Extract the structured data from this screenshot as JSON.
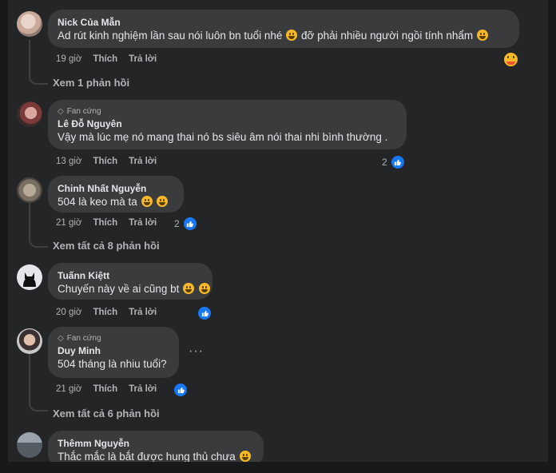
{
  "comments": [
    {
      "name": "Nick Của Mẫn",
      "text": "Ad rút kinh nghiệm lần sau nói luôn bn tuổi nhé",
      "text2": "đỡ phải nhiều người ngồi tính nhẩm",
      "time": "19 giờ",
      "like": "Thích",
      "reply": "Trả lời",
      "replies_link": "Xem 1 phản hồi",
      "reaction": "haha-emoji"
    },
    {
      "badge": "Fan cứng",
      "name": "Lê Đỗ Nguyên",
      "text": "Vậy mà lúc mẹ nó mang thai nó bs siêu âm nói thai nhi bình thường .",
      "time": "13 giờ",
      "like": "Thích",
      "reply": "Trả lời",
      "reaction_count": "2"
    },
    {
      "name": "Chinh Nhất Nguyễn",
      "text": "504 là keo mà ta",
      "time": "21 giờ",
      "like": "Thích",
      "reply": "Trả lời",
      "reaction_count": "2",
      "replies_link": "Xem tất cả 8 phản hồi"
    },
    {
      "name": "Tuấnn Kiệtt",
      "text": "Chuyến này về ai cũng bt",
      "time": "20 giờ",
      "like": "Thích",
      "reply": "Trả lời"
    },
    {
      "badge": "Fan cứng",
      "name": "Duy Minh",
      "text": "504 tháng là nhiu tuổi?",
      "time": "21 giờ",
      "like": "Thích",
      "reply": "Trả lời",
      "more": "···",
      "replies_link": "Xem tất cả 6 phản hồi"
    },
    {
      "name": "Thêmm Nguyễn",
      "text": "Thắc mắc là bắt được hung thủ chưa"
    }
  ],
  "colors": {
    "background": "#242526",
    "bubble": "#3a3b3c",
    "like_blue": "#1877f2",
    "secondary_text": "#b0b3b8"
  }
}
